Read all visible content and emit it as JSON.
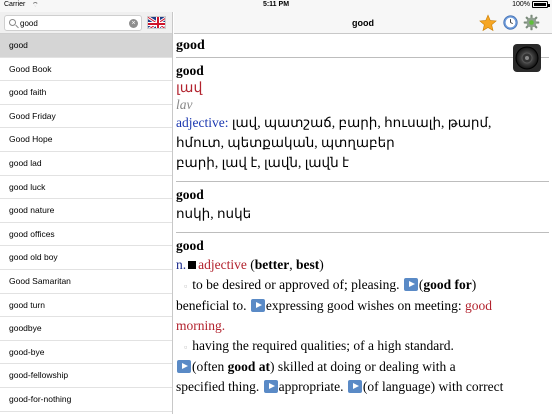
{
  "status": {
    "carrier": "Carrier",
    "time": "5:11 PM",
    "battery": "100%"
  },
  "search": {
    "value": "good",
    "placeholder": ""
  },
  "words": [
    "good",
    "Good Book",
    "good faith",
    "Good Friday",
    "Good Hope",
    "good lad",
    "good luck",
    "good nature",
    "good offices",
    "good old boy",
    "Good Samaritan",
    "good turn",
    "goodbye",
    "good-bye",
    "good-fellowship",
    "good-for-nothing"
  ],
  "nav": {
    "title": "good"
  },
  "entry1": {
    "headword": "good",
    "armenian": "լավ",
    "translit": "lav",
    "pos": "adjective:",
    "meanings1": " լավ, պատշաճ, բարի, հուսալի, թարմ,",
    "meanings2": "հմուտ, պետքական, պտղաբեր",
    "meanings3": "բարի, լավ է, լավն, լավն է"
  },
  "entry2": {
    "headword": "good",
    "meanings": "ոսկի, ոսկե"
  },
  "entry3": {
    "headword": "good",
    "n": "n.",
    "pos": "adjective",
    "comparatives_open": " (",
    "better": "better",
    "comma": ", ",
    "best": "best",
    "comparatives_close": ")",
    "def1": "to be desired or approved of; pleasing.",
    "goodfor": "good for",
    "def1b": "beneficial to.",
    "def1c": "expressing good wishes on meeting:",
    "good_morning_a": "good",
    "good_morning_b": "morning.",
    "def2": "having the required qualities; of a high standard.",
    "often_open": "(often ",
    "goodat": "good at",
    "often_close": ")",
    "def2b": " skilled at doing or dealing with a",
    "def2c": "specified thing.",
    "appropriate": "appropriate.",
    "lang": "(of language) with correct"
  }
}
